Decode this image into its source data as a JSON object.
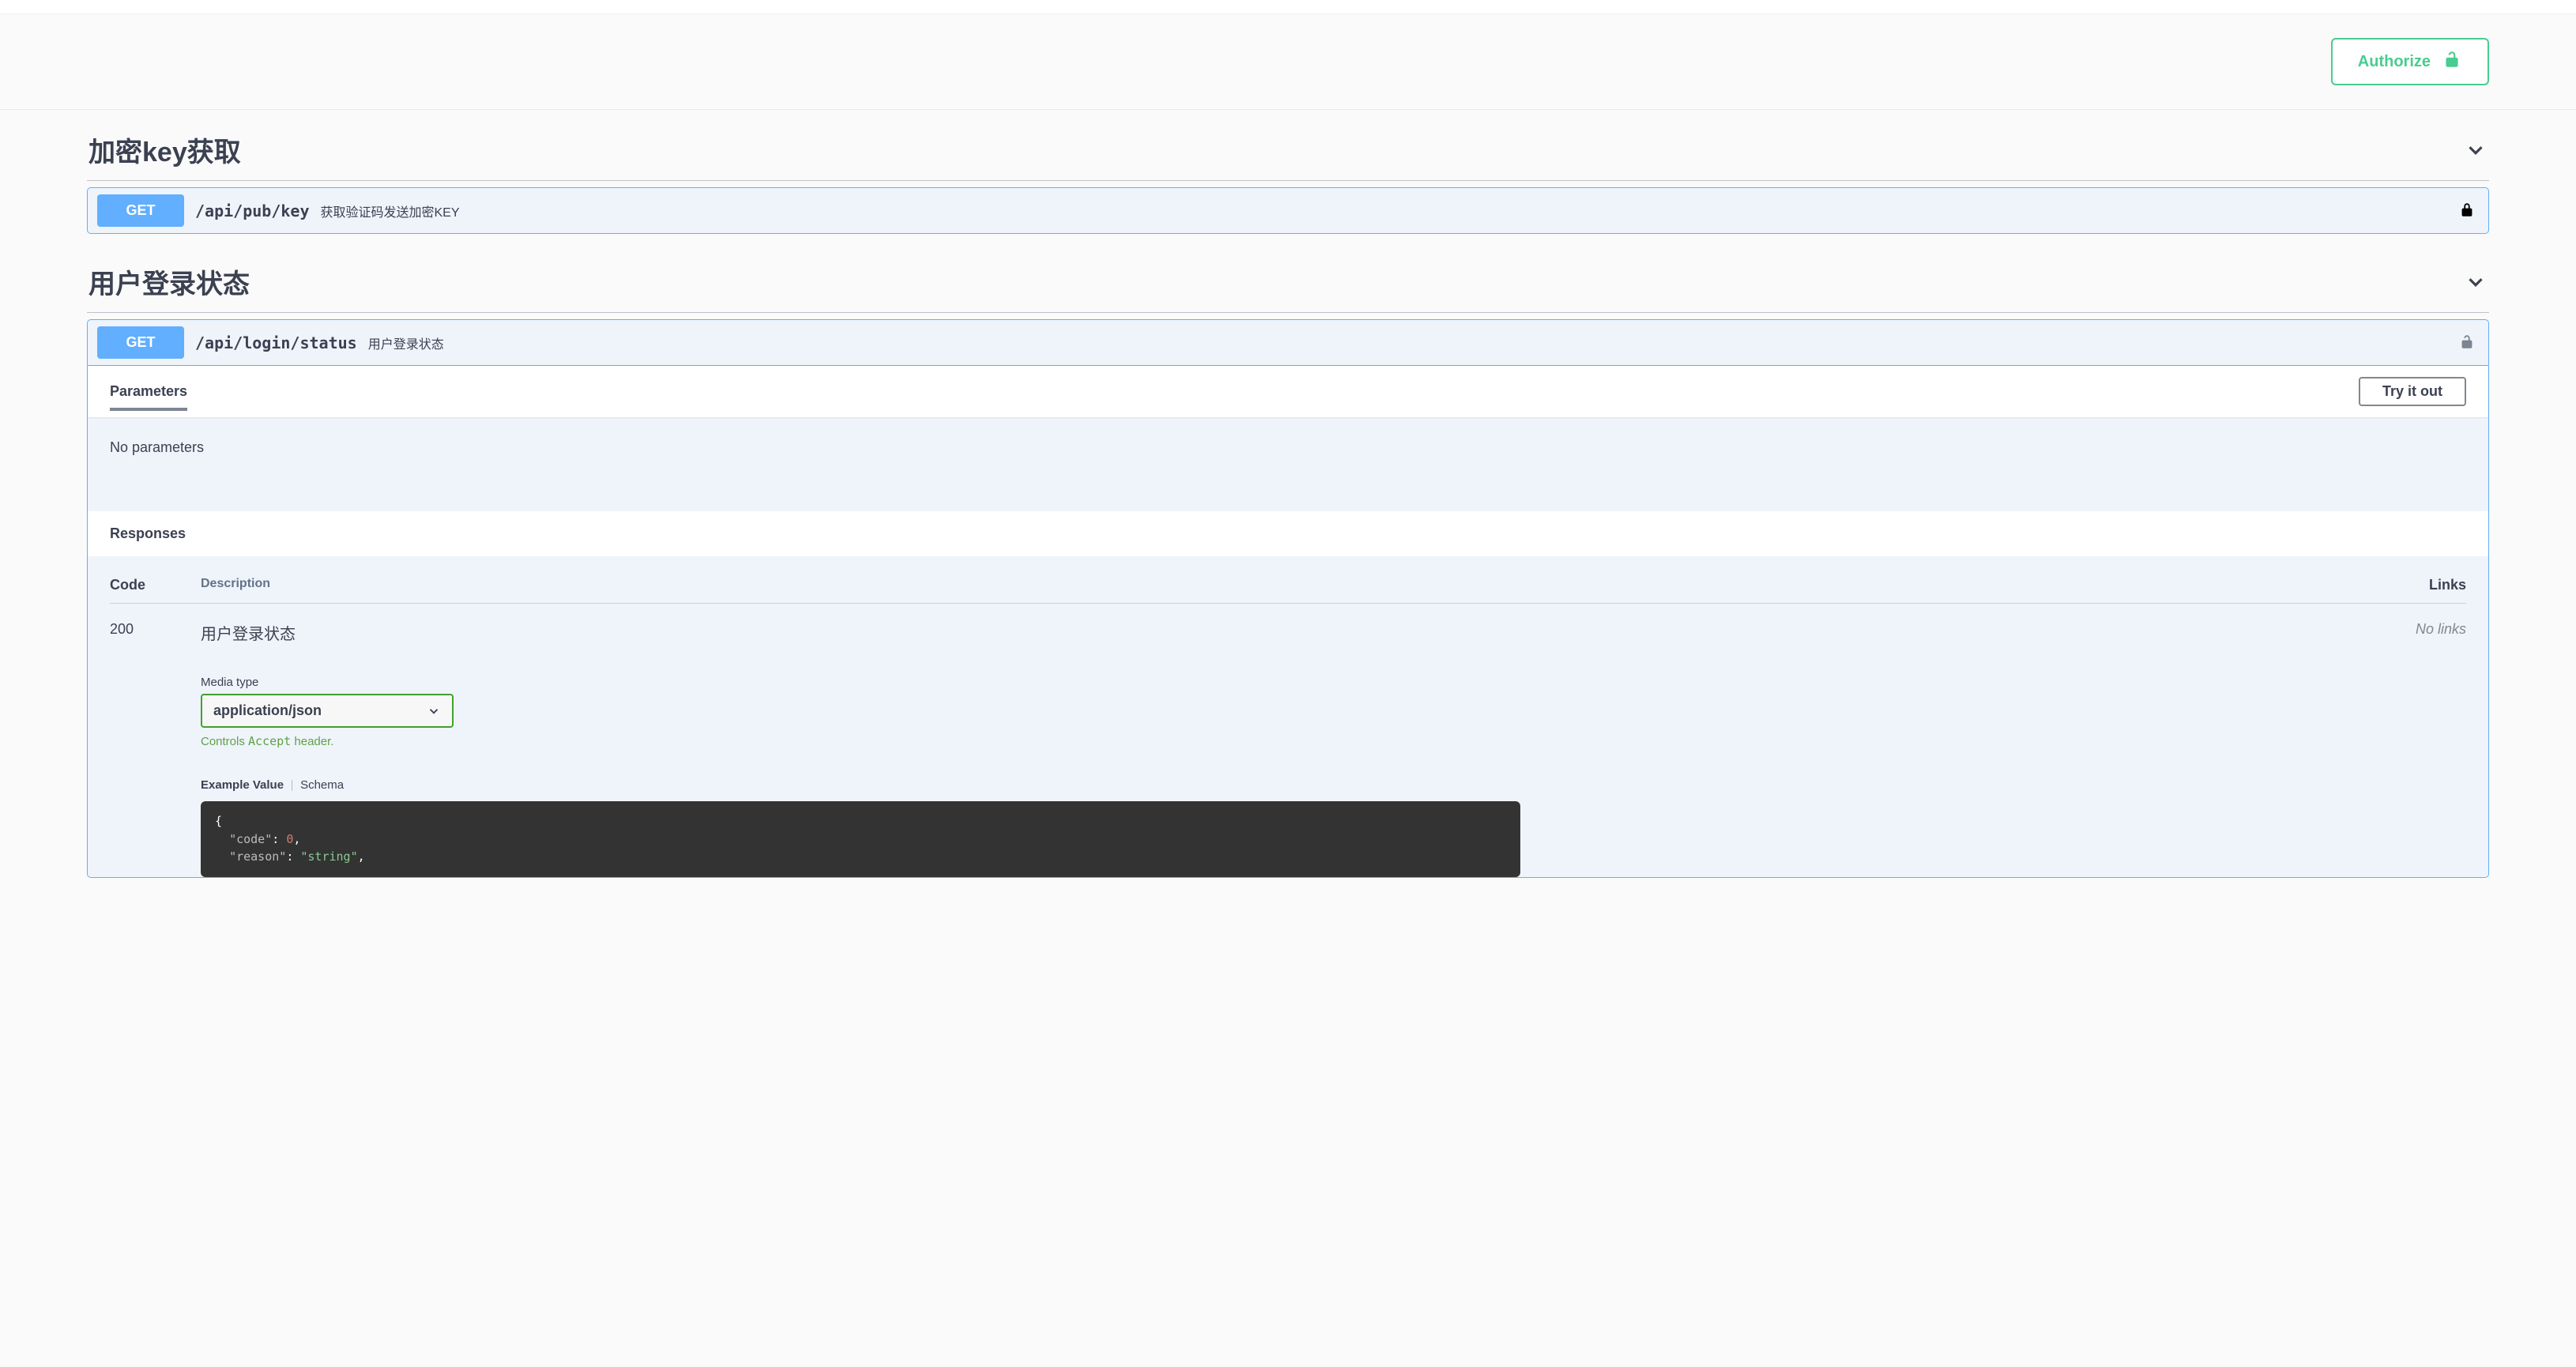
{
  "authorize_label": "Authorize",
  "tags": [
    {
      "title": "加密key获取",
      "ops": [
        {
          "method": "GET",
          "path": "/api/pub/key",
          "summary": "获取验证码发送加密KEY",
          "locked": true,
          "expanded": false
        }
      ]
    },
    {
      "title": "用户登录状态",
      "ops": [
        {
          "method": "GET",
          "path": "/api/login/status",
          "summary": "用户登录状态",
          "locked": false,
          "expanded": true
        }
      ]
    }
  ],
  "parameters_label": "Parameters",
  "no_parameters": "No parameters",
  "try_it_out": "Try it out",
  "responses_label": "Responses",
  "table": {
    "code_header": "Code",
    "description_header": "Description",
    "links_header": "Links",
    "code_value": "200",
    "desc_value": "用户登录状态",
    "no_links": "No links"
  },
  "media_type_label": "Media type",
  "media_type_value": "application/json",
  "controls_prefix": "Controls ",
  "controls_mono": "Accept",
  "controls_suffix": " header.",
  "schema_tabs": {
    "example": "Example Value",
    "schema": "Schema"
  },
  "example_json": {
    "line1_brace": "{",
    "line2_key": "\"code\"",
    "line2_val": "0",
    "line3_key": "\"reason\"",
    "line3_val": "\"string\""
  }
}
